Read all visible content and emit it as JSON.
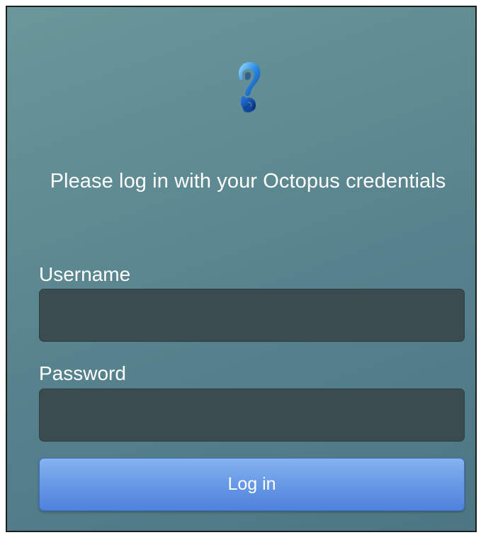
{
  "login": {
    "logo_icon": "octopus-logo-icon",
    "heading": "Please log in with your Octopus credentials",
    "username_label": "Username",
    "username_value": "",
    "password_label": "Password",
    "password_value": "",
    "login_button_label": "Log in"
  },
  "colors": {
    "background_top": "#6a979a",
    "background_bottom": "#4d7684",
    "input_background": "#3a4c50",
    "button_top": "#86b4f0",
    "button_bottom": "#4e82dc",
    "text": "#ffffff"
  }
}
